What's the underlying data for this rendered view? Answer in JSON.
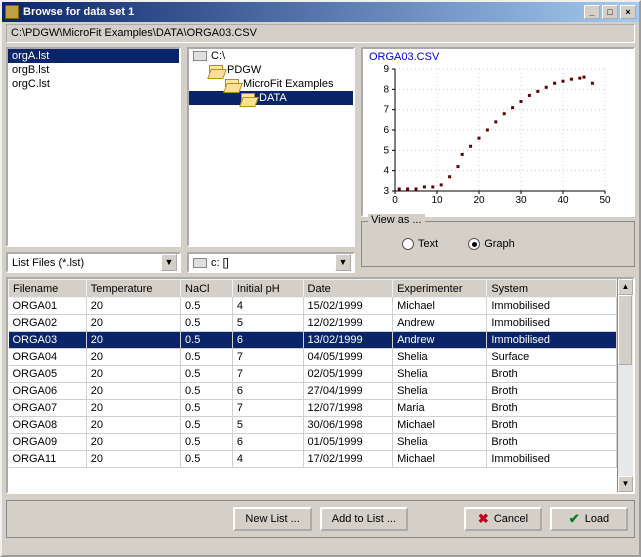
{
  "window": {
    "title": "Browse for data set 1",
    "path": "C:\\PDGW\\MicroFit Examples\\DATA\\ORGA03.CSV"
  },
  "lst_files": {
    "items": [
      "orgA.lst",
      "orgB.lst",
      "orgC.lst"
    ],
    "selected_index": 0
  },
  "lst_filter": "List Files (*.lst)",
  "tree": {
    "items": [
      {
        "label": "C:\\",
        "depth": 0,
        "open": false,
        "kind": "drive",
        "selected": false
      },
      {
        "label": "PDGW",
        "depth": 1,
        "open": true,
        "kind": "folder",
        "selected": false
      },
      {
        "label": "MicroFit Examples",
        "depth": 2,
        "open": true,
        "kind": "folder",
        "selected": false
      },
      {
        "label": "DATA",
        "depth": 3,
        "open": true,
        "kind": "folder",
        "selected": true
      }
    ]
  },
  "drive_selector": "c: []",
  "chart_data": {
    "type": "scatter",
    "title": "ORGA03.CSV",
    "xlabel": "",
    "ylabel": "",
    "xlim": [
      0,
      50
    ],
    "ylim": [
      3,
      9
    ],
    "xticks": [
      0,
      10,
      20,
      30,
      40,
      50
    ],
    "yticks": [
      3,
      4,
      5,
      6,
      7,
      8,
      9
    ],
    "x": [
      1,
      3,
      5,
      7,
      9,
      11,
      13,
      15,
      16,
      18,
      20,
      22,
      24,
      26,
      28,
      30,
      32,
      34,
      36,
      38,
      40,
      42,
      44,
      45,
      47
    ],
    "y": [
      3.1,
      3.1,
      3.1,
      3.2,
      3.2,
      3.3,
      3.7,
      4.2,
      4.8,
      5.2,
      5.6,
      6.0,
      6.4,
      6.8,
      7.1,
      7.4,
      7.7,
      7.9,
      8.1,
      8.3,
      8.4,
      8.5,
      8.55,
      8.6,
      8.3
    ]
  },
  "view_as": {
    "legend": "View as ...",
    "options": [
      "Text",
      "Graph"
    ],
    "selected": "Graph"
  },
  "table": {
    "columns": [
      "Filename",
      "Temperature",
      "NaCl",
      "Initial pH",
      "Date",
      "Experimenter",
      "System"
    ],
    "selected_index": 2,
    "rows": [
      [
        "ORGA01",
        "20",
        "0.5",
        "4",
        "15/02/1999",
        "Michael",
        "Immobilised"
      ],
      [
        "ORGA02",
        "20",
        "0.5",
        "5",
        "12/02/1999",
        "Andrew",
        "Immobilised"
      ],
      [
        "ORGA03",
        "20",
        "0.5",
        "6",
        "13/02/1999",
        "Andrew",
        "Immobilised"
      ],
      [
        "ORGA04",
        "20",
        "0.5",
        "7",
        "04/05/1999",
        "Shelia",
        "Surface"
      ],
      [
        "ORGA05",
        "20",
        "0.5",
        "7",
        "02/05/1999",
        "Shelia",
        "Broth"
      ],
      [
        "ORGA06",
        "20",
        "0.5",
        "6",
        "27/04/1999",
        "Shelia",
        "Broth"
      ],
      [
        "ORGA07",
        "20",
        "0.5",
        "7",
        "12/07/1998",
        "Maria",
        "Broth"
      ],
      [
        "ORGA08",
        "20",
        "0.5",
        "5",
        "30/06/1998",
        "Michael",
        "Broth"
      ],
      [
        "ORGA09",
        "20",
        "0.5",
        "6",
        "01/05/1999",
        "Shelia",
        "Broth"
      ],
      [
        "ORGA11",
        "20",
        "0.5",
        "4",
        "17/02/1999",
        "Michael",
        "Immobilised"
      ]
    ]
  },
  "buttons": {
    "new_list": "New List ...",
    "add_to_list": "Add to List ...",
    "cancel": "Cancel",
    "load": "Load"
  }
}
